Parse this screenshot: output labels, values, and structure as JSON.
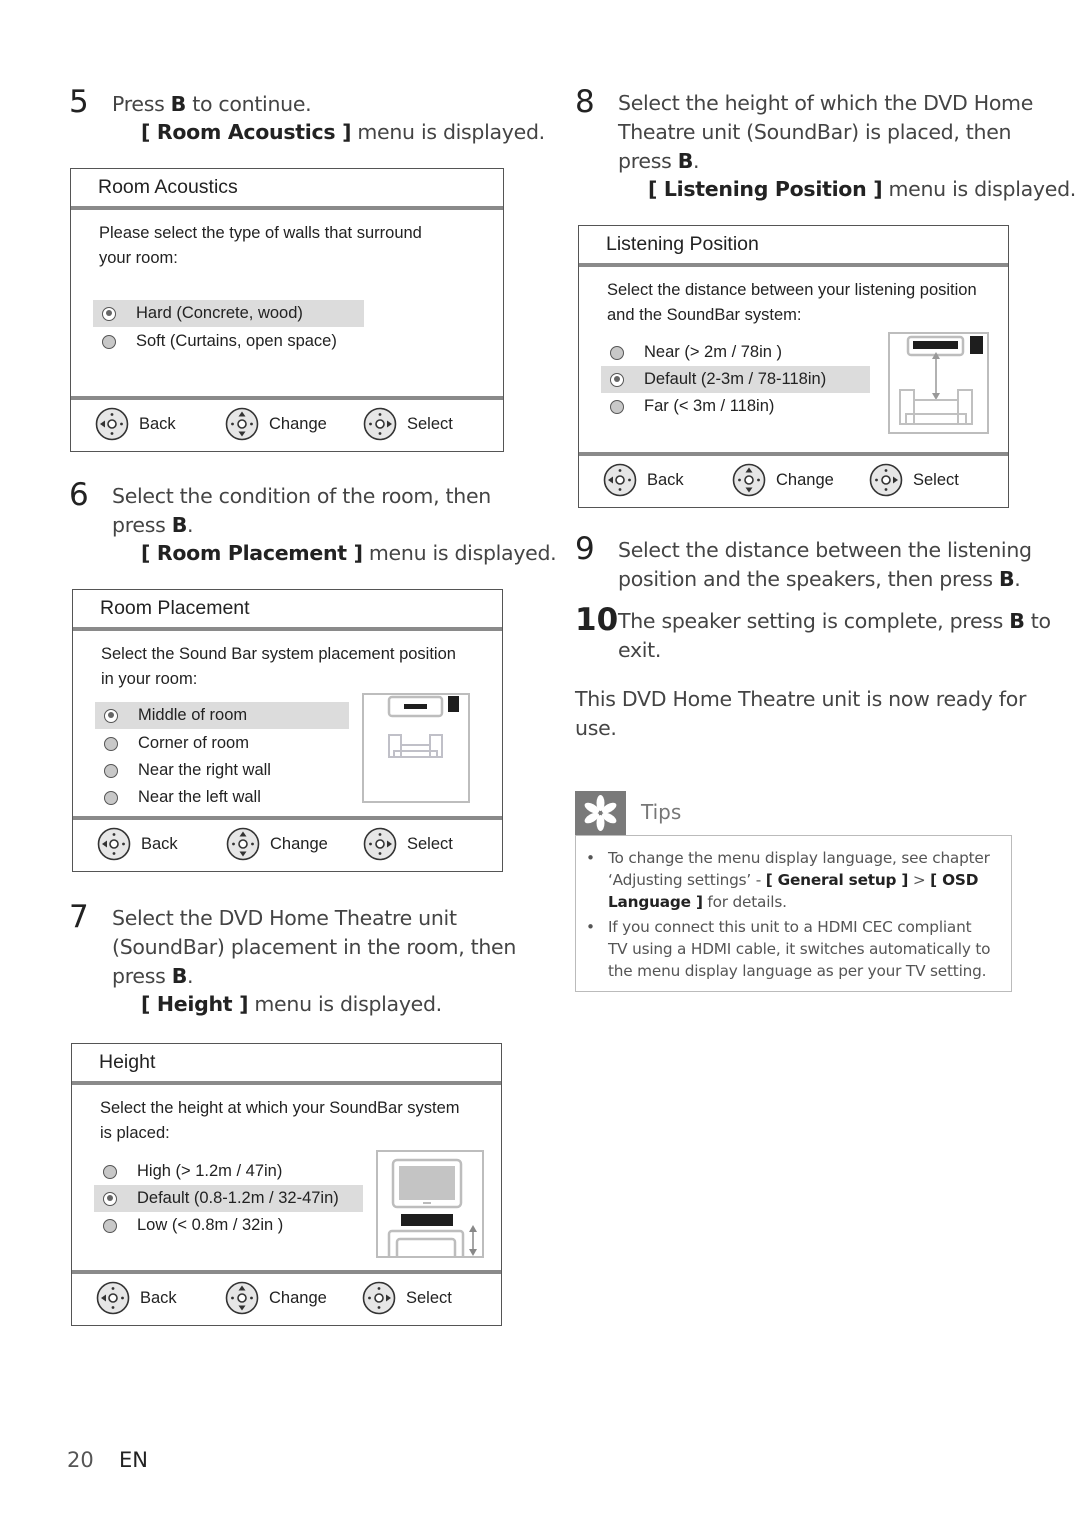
{
  "steps": {
    "s5": {
      "num": "5",
      "line1_a": "Press ",
      "key": "B",
      "line1_b": " to continue.",
      "sub_open": "[ ",
      "sub_menu": "Room Acoustics",
      "sub_close": " ]",
      "sub_tail": " menu is displayed."
    },
    "s6": {
      "num": "6",
      "line1": "Select the condition of the room, then",
      "line2_a": "press ",
      "key": "B",
      "line2_b": ".",
      "sub_open": "[ ",
      "sub_menu": "Room Placement",
      "sub_close": " ]",
      "sub_tail": " menu is displayed."
    },
    "s7": {
      "num": "7",
      "line1": "Select the DVD Home Theatre unit",
      "line2": "(SoundBar) placement in the room, then",
      "line3_a": "press ",
      "key": "B",
      "line3_b": ".",
      "sub_open": "[ ",
      "sub_menu": "Height",
      "sub_close": " ]",
      "sub_tail": " menu is displayed."
    },
    "s8": {
      "num": "8",
      "line1": "Select the height of which the DVD Home",
      "line2": "Theatre unit (SoundBar) is placed, then",
      "line3_a": "press ",
      "key": "B",
      "line3_b": ".",
      "sub_open": "[ ",
      "sub_menu": "Listening Position",
      "sub_close": " ]",
      "sub_tail": " menu is displayed."
    },
    "s9": {
      "num": "9",
      "line1": "Select the distance between the listening",
      "line2_a": "position and the speakers, then press ",
      "key": "B",
      "line2_b": "."
    },
    "s10": {
      "num": "10",
      "line1_a": "The speaker setting is complete, press ",
      "key": "B",
      "line1_b": " to",
      "line2": "exit."
    }
  },
  "ready_text": {
    "line1": "This DVD Home Theatre unit is now ready for",
    "line2": "use."
  },
  "menus": {
    "acoustics": {
      "title": "Room Acoustics",
      "desc1": "Please select the type of walls that surround",
      "desc2": "your room:",
      "options": [
        {
          "label": "Hard (Concrete, wood)",
          "selected": true
        },
        {
          "label": "Soft (Curtains, open space)",
          "selected": false
        }
      ]
    },
    "placement": {
      "title": "Room Placement",
      "desc1": "Select the Sound Bar system placement position",
      "desc2": "in your room:",
      "options": [
        {
          "label": "Middle of room",
          "selected": true
        },
        {
          "label": "Corner of room",
          "selected": false
        },
        {
          "label": "Near the right wall",
          "selected": false
        },
        {
          "label": "Near the left wall",
          "selected": false
        }
      ]
    },
    "height": {
      "title": "Height",
      "desc1": "Select the height at which your SoundBar system",
      "desc2": "is placed:",
      "options": [
        {
          "label": "High (> 1.2m / 47in)",
          "selected": false
        },
        {
          "label": "Default (0.8-1.2m / 32-47in)",
          "selected": true
        },
        {
          "label": "Low (< 0.8m / 32in )",
          "selected": false
        }
      ]
    },
    "listening": {
      "title": "Listening Position",
      "desc1": "Select the distance between your listening position",
      "desc2": "and the SoundBar system:",
      "options": [
        {
          "label": "Near (> 2m / 78in )",
          "selected": false
        },
        {
          "label": "Default (2-3m / 78-118in)",
          "selected": true
        },
        {
          "label": "Far (< 3m / 118in)",
          "selected": false
        }
      ]
    },
    "footer": {
      "back": "Back",
      "change": "Change",
      "select": "Select"
    }
  },
  "tips": {
    "label": "Tips",
    "icon": "asterisk-icon",
    "items": [
      {
        "l1": "To change the menu display language, see chapter",
        "l2_a": "‘Adjusting settings’ - ",
        "l2_b": "[ General setup ]",
        "l2_c": " > ",
        "l2_d": "[ OSD",
        "l3_a": "Language ]",
        "l3_b": " for details."
      },
      {
        "l1": "If you connect this unit to a HDMI CEC compliant",
        "l2": "TV using a HDMI cable, it switches automatically to",
        "l3": "the menu display language as per your TV setting."
      }
    ]
  },
  "footer": {
    "page_number": "20",
    "language": "EN"
  },
  "colors": {
    "highlight": "#dcdcdc",
    "separator": "#8a8a8a",
    "tips_icon_bg": "#7a7a7a",
    "soundbar": "#1e1e1e"
  }
}
